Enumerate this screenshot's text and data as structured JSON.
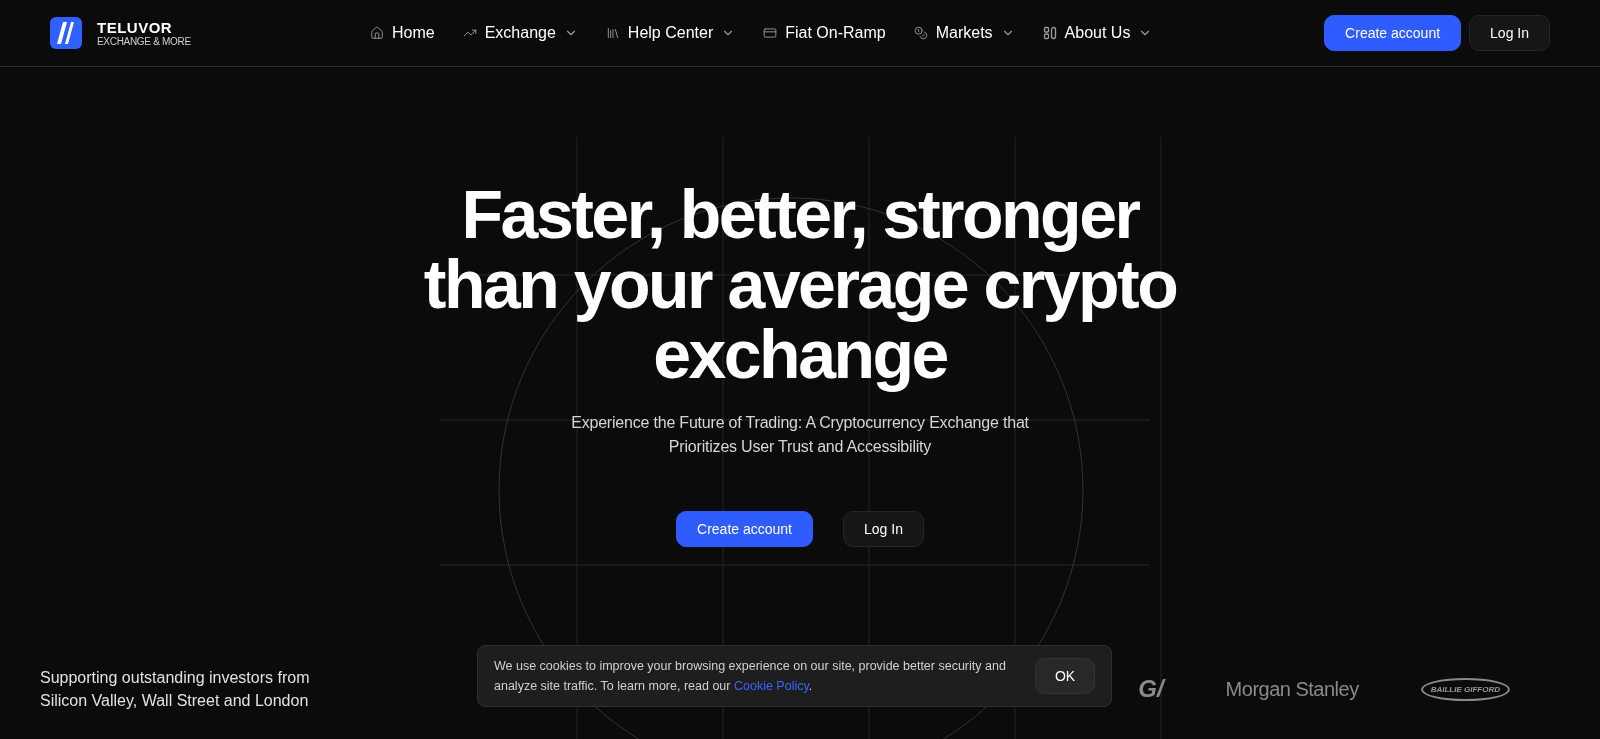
{
  "brand": {
    "name": "TELUVOR",
    "tagline": "EXCHANGE & MORE"
  },
  "nav": [
    {
      "label": "Home",
      "dropdown": false
    },
    {
      "label": "Exchange",
      "dropdown": true
    },
    {
      "label": "Help Center",
      "dropdown": true
    },
    {
      "label": "Fiat On-Ramp",
      "dropdown": false
    },
    {
      "label": "Markets",
      "dropdown": true
    },
    {
      "label": "About Us",
      "dropdown": true
    }
  ],
  "header_buttons": [
    {
      "label": "Create account",
      "kind": "primary"
    },
    {
      "label": "Log In",
      "kind": "secondary"
    }
  ],
  "hero": {
    "title_lines": [
      "Faster, better, stronger",
      "than your average crypto",
      "exchange"
    ],
    "subtitle_lines": [
      "Experience the Future of Trading: A Cryptocurrency Exchange that",
      "Prioritizes User Trust and Accessibility"
    ],
    "buttons": [
      {
        "label": "Create account",
        "kind": "primary"
      },
      {
        "label": "Log In",
        "kind": "secondary"
      }
    ]
  },
  "supporters": {
    "text_lines": [
      "Supporting outstanding investors from",
      "Silicon Valley, Wall Street and London"
    ],
    "logos": [
      {
        "label": "G/",
        "kind": "mark"
      },
      {
        "label": "Morgan Stanley",
        "kind": "wordmark"
      },
      {
        "label": "BAILLIE GIFFORD",
        "kind": "oval"
      }
    ]
  },
  "cookie_banner": {
    "text": "We use cookies to improve your browsing experience on our site, provide better security and analyze site traffic. To learn more, read our",
    "link": "Cookie Policy",
    "after": ".",
    "button": "OK"
  }
}
